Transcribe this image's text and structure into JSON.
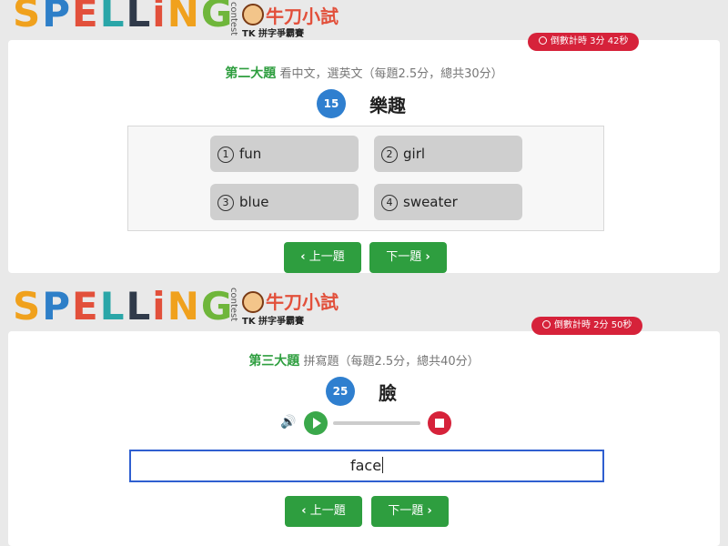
{
  "logo": {
    "letters": [
      {
        "ch": "S",
        "color": "#f0a11d"
      },
      {
        "ch": "P",
        "color": "#2e7fc8"
      },
      {
        "ch": "E",
        "color": "#e2503b"
      },
      {
        "ch": "L",
        "color": "#2aa6a8"
      },
      {
        "ch": "L",
        "color": "#303a4a"
      },
      {
        "ch": "i",
        "color": "#e2503b"
      },
      {
        "ch": "N",
        "color": "#f0a11d"
      },
      {
        "ch": "G",
        "color": "#6fb63b"
      }
    ],
    "contest": "contest",
    "brand": "牛刀小試",
    "subbrand": "TK 拼字爭霸賽"
  },
  "colors": {
    "accent_green": "#2e9e3f",
    "accent_blue": "#2f7fcf",
    "timer_red": "#d6223a"
  },
  "panel1": {
    "timer": "倒數計時 3分 42秒",
    "section_title": "第二大題",
    "section_desc": "看中文，選英文（每題2.5分，總共30分）",
    "question_number": "15",
    "question_word": "樂趣",
    "options": [
      {
        "num": "1",
        "text": "fun"
      },
      {
        "num": "2",
        "text": "girl"
      },
      {
        "num": "3",
        "text": "blue"
      },
      {
        "num": "4",
        "text": "sweater"
      }
    ],
    "prev_label": "上一題",
    "next_label": "下一題"
  },
  "panel2": {
    "timer": "倒數計時 2分 50秒",
    "section_title": "第三大題",
    "section_desc": "拼寫題（每題2.5分，總共40分）",
    "question_number": "25",
    "question_word": "臉",
    "answer_value": "face",
    "prev_label": "上一題",
    "next_label": "下一題",
    "icons": {
      "speaker": "speaker-icon",
      "play": "play-icon",
      "stop": "stop-icon"
    }
  }
}
